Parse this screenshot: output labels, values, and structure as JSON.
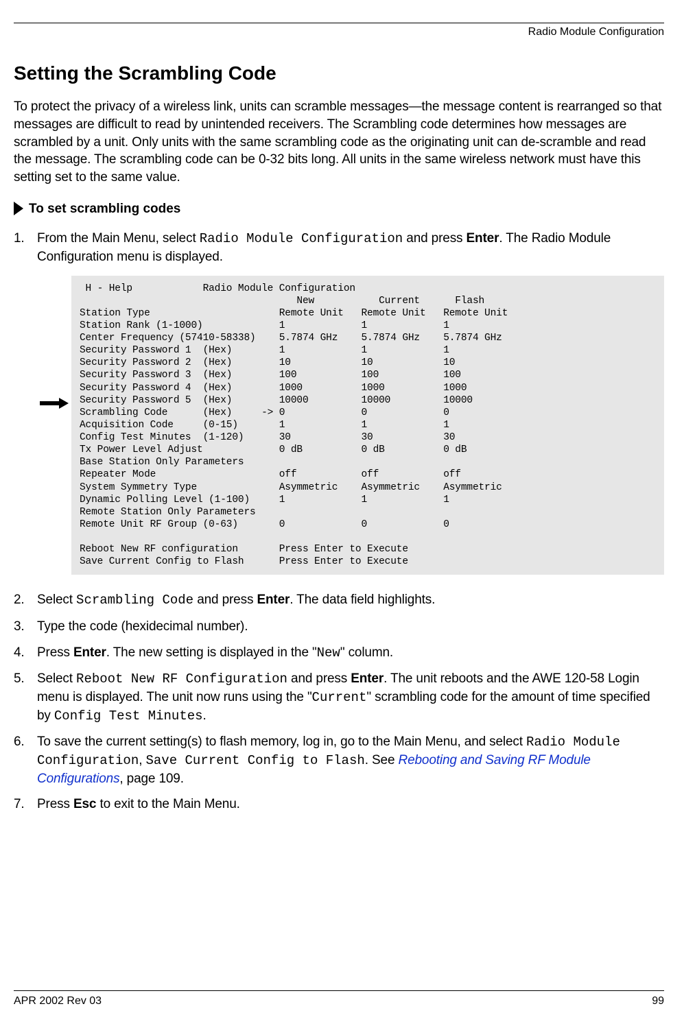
{
  "header": {
    "running_head": "Radio Module Configuration"
  },
  "title": "Setting the Scrambling Code",
  "intro": "To protect the privacy of a wireless link, units can scramble messages—the message content is rearranged so that messages are difficult to read by unintended receivers. The Scrambling code determines how messages are scrambled by a unit. Only units with the same scrambling code as the originating unit can de-scramble and read the message. The scrambling code can be 0-32 bits long. All units in the same wireless network must have this setting set to the same value.",
  "subhead": "To set scrambling codes",
  "steps": {
    "s1_a": "From the Main Menu, select ",
    "s1_code": "Radio Module Configuration",
    "s1_b": " and press ",
    "s1_bold": "Enter",
    "s1_c": ". The Radio Module Configuration menu is displayed.",
    "s2_a": "Select ",
    "s2_code": "Scrambling Code",
    "s2_b": " and press ",
    "s2_bold": "Enter",
    "s2_c": ". The data field highlights.",
    "s3": "Type the code (hexidecimal number).",
    "s4_a": "Press ",
    "s4_bold": "Enter",
    "s4_b": ". The new setting is displayed in the \"",
    "s4_code": "New",
    "s4_c": "\" column.",
    "s5_a": "Select ",
    "s5_code1": "Reboot New RF Configuration",
    "s5_b": " and press ",
    "s5_bold": "Enter",
    "s5_c": ". The unit reboots and the AWE 120-58 Login menu is displayed. The unit now runs using the \"",
    "s5_code2": "Current",
    "s5_d": "\" scrambling code for the amount of time specified by ",
    "s5_code3": "Config Test Minutes",
    "s5_e": ".",
    "s6_a": "To save the current setting(s) to flash memory, log in, go to the Main Menu, and select ",
    "s6_code1": "Radio Module Configuration",
    "s6_b": ", ",
    "s6_code2": "Save Current Config to Flash",
    "s6_c": ". See ",
    "s6_link": "Rebooting and Saving RF Module Configurations",
    "s6_d": ", page 109.",
    "s7_a": "Press ",
    "s7_bold": "Esc",
    "s7_b": " to exit to the Main Menu."
  },
  "terminal": {
    "help_key": "H - Help",
    "title": "Radio Module Configuration",
    "col_new": "New",
    "col_current": "Current",
    "col_flash": "Flash",
    "rows": [
      {
        "label": "Station Type",
        "new": "Remote Unit",
        "current": "Remote Unit",
        "flash": "Remote Unit"
      },
      {
        "label": "Station Rank (1-1000)",
        "new": "1",
        "current": "1",
        "flash": "1"
      },
      {
        "label": "Center Frequency (57410-58338)",
        "new": "5.7874 GHz",
        "current": "5.7874 GHz",
        "flash": "5.7874 GHz"
      },
      {
        "label": "Security Password 1  (Hex)",
        "new": "1",
        "current": "1",
        "flash": "1"
      },
      {
        "label": "Security Password 2  (Hex)",
        "new": "10",
        "current": "10",
        "flash": "10"
      },
      {
        "label": "Security Password 3  (Hex)",
        "new": "100",
        "current": "100",
        "flash": "100"
      },
      {
        "label": "Security Password 4  (Hex)",
        "new": "1000",
        "current": "1000",
        "flash": "1000"
      },
      {
        "label": "Security Password 5  (Hex)",
        "new": "10000",
        "current": "10000",
        "flash": "10000"
      },
      {
        "label": "Scrambling Code      (Hex)",
        "marker": "->",
        "new": "0",
        "current": "0",
        "flash": "0"
      },
      {
        "label": "Acquisition Code     (0-15)",
        "new": "1",
        "current": "1",
        "flash": "1"
      },
      {
        "label": "Config Test Minutes  (1-120)",
        "new": "30",
        "current": "30",
        "flash": "30"
      },
      {
        "label": "Tx Power Level Adjust",
        "new": "0 dB",
        "current": "0 dB",
        "flash": "0 dB"
      },
      {
        "label": "Base Station Only Parameters"
      },
      {
        "label": "Repeater Mode",
        "new": "off",
        "current": "off",
        "flash": "off"
      },
      {
        "label": "System Symmetry Type",
        "new": "Asymmetric",
        "current": "Asymmetric",
        "flash": "Asymmetric"
      },
      {
        "label": "Dynamic Polling Level (1-100)",
        "new": "1",
        "current": "1",
        "flash": "1"
      },
      {
        "label": "Remote Station Only Parameters"
      },
      {
        "label": "Remote Unit RF Group (0-63)",
        "new": "0",
        "current": "0",
        "flash": "0"
      }
    ],
    "action1": {
      "label": "Reboot New RF configuration",
      "value": "Press Enter to Execute"
    },
    "action2": {
      "label": "Save Current Config to Flash",
      "value": "Press Enter to Execute"
    }
  },
  "footer": {
    "left": "APR 2002 Rev 03",
    "right": "99"
  }
}
